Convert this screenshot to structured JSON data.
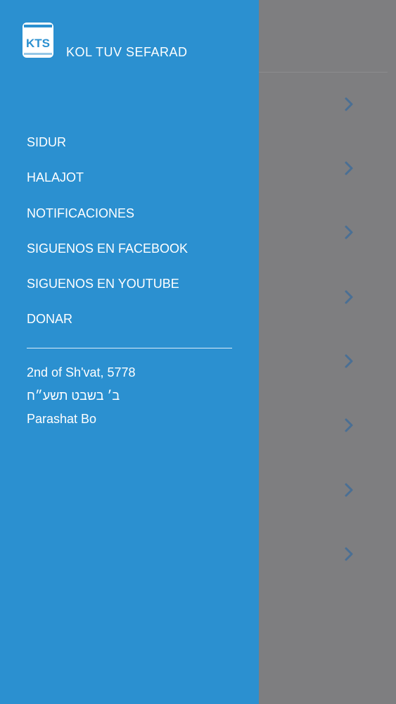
{
  "app": {
    "logo_text": "KTS",
    "title": "KOL TUV SEFARAD"
  },
  "menu": {
    "items": [
      {
        "label": "SIDUR"
      },
      {
        "label": "HALAJOT"
      },
      {
        "label": "NOTIFICACIONES"
      },
      {
        "label": "SIGUENOS EN FACEBOOK"
      },
      {
        "label": "SIGUENOS EN YOUTUBE"
      },
      {
        "label": "DONAR"
      }
    ]
  },
  "date": {
    "gregorian_hebrew": "2nd of Sh'vat, 5778",
    "hebrew": "ב׳ בשבט תשע״ח",
    "parasha": "Parashat Bo"
  },
  "background_list": {
    "chevron_icon": "chevron-right-icon",
    "row_count": 8
  },
  "colors": {
    "drawer_bg": "#2b90d0",
    "overlay_bg": "#7e7e80",
    "chevron": "#4a6f94"
  }
}
